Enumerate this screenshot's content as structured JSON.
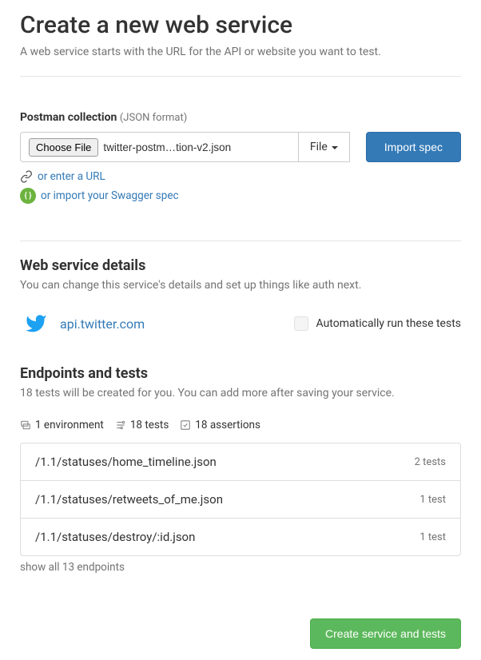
{
  "header": {
    "title": "Create a new web service",
    "subtitle": "A web service starts with the URL for the API or website you want to test."
  },
  "import": {
    "label": "Postman collection",
    "hint": "(JSON format)",
    "choose_file_btn": "Choose File",
    "selected_file": "twitter-postm…tion-v2.json",
    "dropdown_label": "File",
    "import_btn": "Import spec",
    "url_link": "or enter a URL",
    "swagger_link": "or import your Swagger spec"
  },
  "details": {
    "heading": "Web service details",
    "desc": "You can change this service's details and set up things like auth next.",
    "service_url": "api.twitter.com",
    "auto_run_label": "Automatically run these tests"
  },
  "endpoints": {
    "heading": "Endpoints and tests",
    "desc": "18 tests will be created for you. You can add more after saving your service.",
    "stats": {
      "env": "1 environment",
      "tests": "18 tests",
      "assertions": "18 assertions"
    },
    "items": [
      {
        "path": "/1.1/statuses/home_timeline.json",
        "count": "2 tests"
      },
      {
        "path": "/1.1/statuses/retweets_of_me.json",
        "count": "1 test"
      },
      {
        "path": "/1.1/statuses/destroy/:id.json",
        "count": "1 test"
      }
    ],
    "show_all": "show all 13 endpoints"
  },
  "footer": {
    "create_btn": "Create service and tests"
  }
}
